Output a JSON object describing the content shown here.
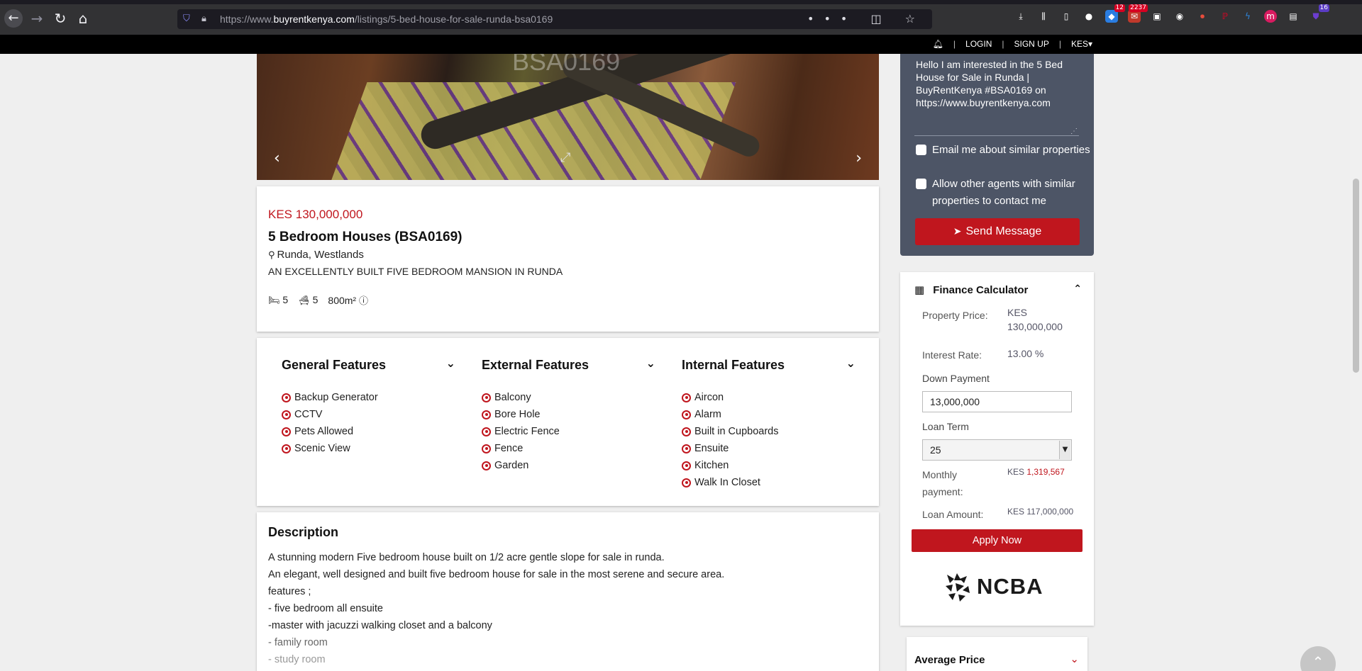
{
  "browser": {
    "url_prefix": "https://www.",
    "url_domain": "buyrentkenya.com",
    "url_path": "/listings/5-bed-house-for-sale-runda-bsa0169",
    "url_actions": "••• ◫ ☆",
    "badges": {
      "ext1": "12",
      "mail": "2237",
      "last": "16"
    }
  },
  "topbar": {
    "login": "LOGIN",
    "signup": "SIGN UP",
    "currency": "KES▾"
  },
  "carousel": {
    "watermark": "BSA0169"
  },
  "listing": {
    "price": "KES 130,000,000",
    "title": "5 Bedroom Houses (BSA0169)",
    "location": "Runda, Westlands",
    "tagline": "AN EXCELLENTLY BUILT FIVE BEDROOM MANSION IN RUNDA",
    "beds": "5",
    "baths": "5",
    "area": "800m²"
  },
  "features": {
    "general": {
      "title": "General Features",
      "items": [
        "Backup Generator",
        "CCTV",
        "Pets Allowed",
        "Scenic View"
      ]
    },
    "external": {
      "title": "External Features",
      "items": [
        "Balcony",
        "Bore Hole",
        "Electric Fence",
        "Fence",
        "Garden"
      ]
    },
    "internal": {
      "title": "Internal Features",
      "items": [
        "Aircon",
        "Alarm",
        "Built in Cupboards",
        "Ensuite",
        "Kitchen",
        "Walk In Closet"
      ]
    }
  },
  "description": {
    "heading": "Description",
    "lines": [
      "A stunning modern Five bedroom house built on 1/2 acre gentle slope for sale in runda.",
      "An elegant, well designed and built five bedroom house for sale in the most serene and secure area.",
      "features ;",
      "- five bedroom all ensuite",
      "-master with jacuzzi walking closet and a balcony",
      "- family room",
      "- study room"
    ]
  },
  "contact": {
    "message": "Hello I am interested in the 5 Bed House for Sale in Runda | BuyRentKenya #BSA0169 on https://www.buyrentkenya.com",
    "check_similar": "Email me about similar properties",
    "check_agents": "Allow other agents with similar properties to contact me",
    "send": "Send Message"
  },
  "finance": {
    "title": "Finance Calculator",
    "property_price_label": "Property Price:",
    "property_price_currency": "KES",
    "property_price_value": "130,000,000",
    "interest_label": "Interest Rate:",
    "interest_value": "13.00 %",
    "down_payment_label": "Down Payment",
    "down_payment_value": "13,000,000",
    "loan_term_label": "Loan Term",
    "loan_term_value": "25",
    "monthly_label": "Monthly payment:",
    "monthly_currency": "KES",
    "monthly_value": "1,319,567",
    "loan_amount_label": "Loan Amount:",
    "loan_amount_value": "KES 117,000,000",
    "apply": "Apply Now",
    "brand": "NCBA"
  },
  "average_price": {
    "title": "Average Price"
  },
  "colors": {
    "accent": "#c0161e",
    "sidebar_card": "#4d5566",
    "topbar": "#000000"
  }
}
